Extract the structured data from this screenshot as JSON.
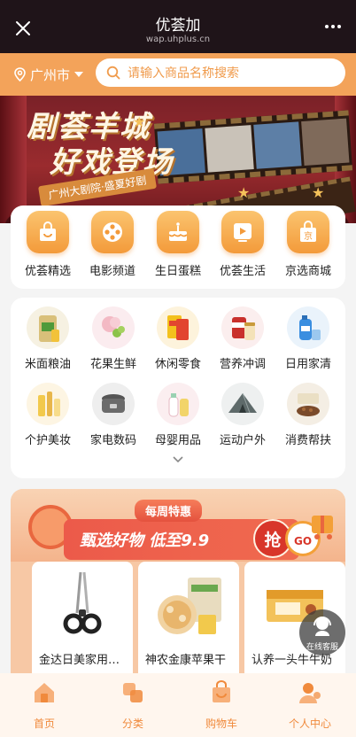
{
  "navbar": {
    "title": "优荟加",
    "subtitle": "wap.uhplus.cn"
  },
  "location": {
    "city": "广州市"
  },
  "search": {
    "placeholder": "请输入商品名称搜索"
  },
  "banner": {
    "headline_1": "剧荟羊城",
    "headline_2": "好戏登场",
    "tagline": "广州大剧院·盛夏好剧"
  },
  "top_categories": [
    {
      "label": "优荟精选",
      "icon": "shopping-bag-icon"
    },
    {
      "label": "电影频道",
      "icon": "film-reel-icon"
    },
    {
      "label": "生日蛋糕",
      "icon": "birthday-cake-icon"
    },
    {
      "label": "优荟生活",
      "icon": "play-tablet-icon"
    },
    {
      "label": "京选商城",
      "icon": "jd-bag-icon"
    }
  ],
  "product_categories": [
    {
      "label": "米面粮油",
      "icon": "rice-bag-icon"
    },
    {
      "label": "花果生鲜",
      "icon": "fruit-flower-icon"
    },
    {
      "label": "休闲零食",
      "icon": "snacks-icon"
    },
    {
      "label": "营养冲调",
      "icon": "nutrition-can-icon"
    },
    {
      "label": "日用家清",
      "icon": "detergent-icon"
    },
    {
      "label": "个护美妆",
      "icon": "cosmetics-icon"
    },
    {
      "label": "家电数码",
      "icon": "rice-cooker-icon"
    },
    {
      "label": "母婴用品",
      "icon": "baby-products-icon"
    },
    {
      "label": "运动户外",
      "icon": "tent-icon"
    },
    {
      "label": "消费帮扶",
      "icon": "local-produce-icon"
    }
  ],
  "promo": {
    "flag": "每周特惠",
    "headline": "甄选好物 低至9.9",
    "grab": "抢",
    "go": "GO"
  },
  "products": [
    {
      "name": "金达日美家用剪刀",
      "icon": "scissors-icon"
    },
    {
      "name": "神农金康苹果干",
      "icon": "dried-fruit-icon"
    },
    {
      "name": "认养一头牛牛奶",
      "icon": "milk-box-icon"
    }
  ],
  "service": {
    "label": "在线客服"
  },
  "tabs": [
    {
      "label": "首页",
      "icon": "home-icon"
    },
    {
      "label": "分类",
      "icon": "category-icon"
    },
    {
      "label": "购物车",
      "icon": "cart-icon"
    },
    {
      "label": "个人中心",
      "icon": "profile-icon"
    }
  ],
  "colors": {
    "accent": "#f3a35a",
    "navbar": "#1f1419",
    "tab_text": "#f08a3c",
    "promo_red": "#ec5a4a"
  }
}
